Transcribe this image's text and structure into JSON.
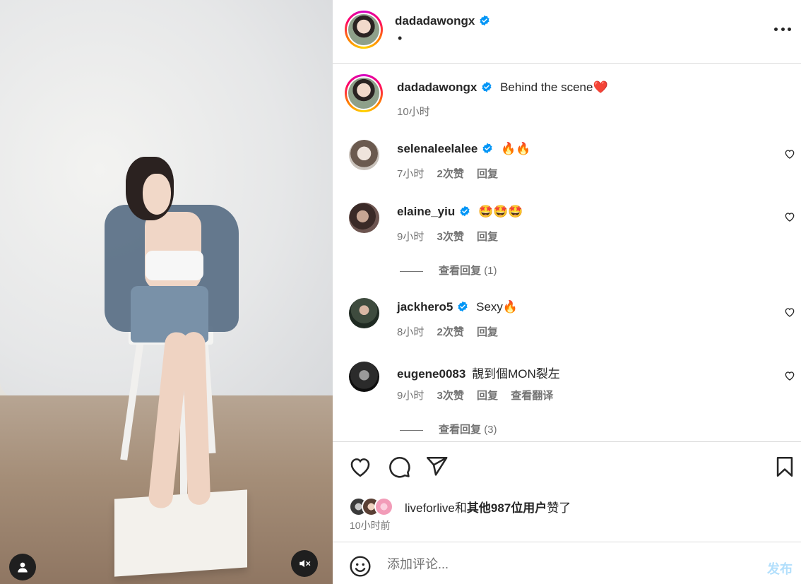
{
  "colors": {
    "brand_blue": "#0095f6",
    "verified_blue": "#0095f6",
    "muted_text": "#737373",
    "post_button_disabled": "#b2dffc",
    "divider": "#dbdbdb"
  },
  "media": {
    "profile_icon": "user-icon",
    "mute_icon": "speaker-muted-icon"
  },
  "header": {
    "username": "dadadawongx",
    "subtitle": "•",
    "more_icon": "more-horizontal-icon"
  },
  "caption": {
    "username": "dadadawongx",
    "text": "Behind the scene❤️",
    "time": "10小时"
  },
  "comments": [
    {
      "username": "selenaleelalee",
      "verified": true,
      "text": "🔥🔥",
      "time": "7小时",
      "likes": "2次赞",
      "reply": "回复"
    },
    {
      "username": "elaine_yiu",
      "verified": true,
      "text": "🤩🤩🤩",
      "time": "9小时",
      "likes": "3次赞",
      "reply": "回复",
      "view_replies": "查看回复",
      "view_replies_count": "(1)"
    },
    {
      "username": "jackhero5",
      "verified": true,
      "text": "Sexy🔥",
      "time": "8小时",
      "likes": "2次赞",
      "reply": "回复"
    },
    {
      "username": "eugene0083",
      "verified": false,
      "text": "靚到個MON裂左",
      "time": "9小时",
      "likes": "3次赞",
      "reply": "回复",
      "translate": "查看翻译",
      "view_replies": "查看回复",
      "view_replies_count": "(3)"
    }
  ],
  "actions": {
    "like_icon": "heart-icon",
    "comment_icon": "comment-bubble-icon",
    "share_icon": "paper-plane-icon",
    "save_icon": "bookmark-icon"
  },
  "likes": {
    "first_user": "liveforlive",
    "connector": "和",
    "others": "其他987位用户",
    "suffix": "赞了",
    "time_ago": "10小时前"
  },
  "composer": {
    "emoji_icon": "emoji-smile-icon",
    "placeholder": "添加评论...",
    "value": "",
    "post_label": "发布"
  }
}
